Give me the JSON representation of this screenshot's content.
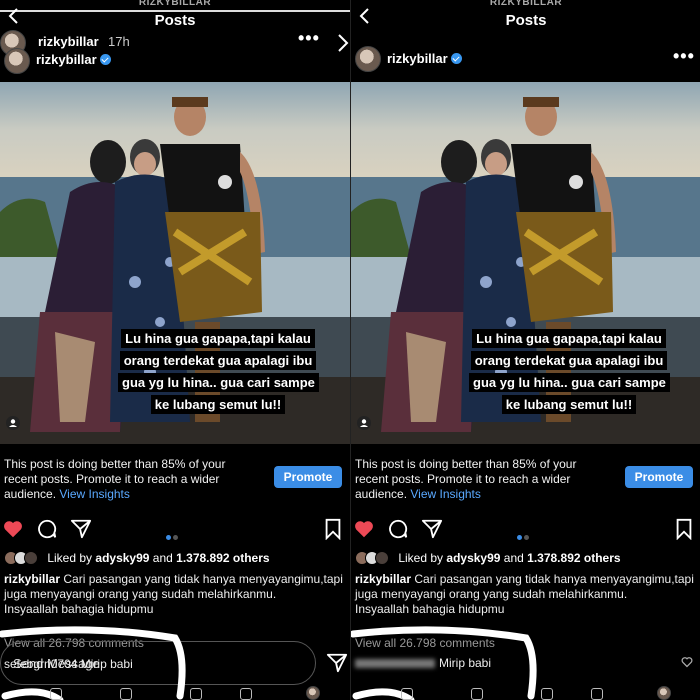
{
  "pretitle": "RIZKYBILLAR",
  "title": "Posts",
  "story": {
    "username": "rizkybillar",
    "time": "17h"
  },
  "post": {
    "username": "rizkybillar",
    "overlay_text": "Lu hina gua gapapa,tapi kalau orang terdekat gua apalagi ibu gua yg lu hina.. gua cari sampe ke lubang semut lu!!"
  },
  "insight": {
    "text": "This post is doing better than 85% of your recent posts. Promote it to reach a wider audience.",
    "link": "View Insights",
    "button": "Promote"
  },
  "likes": {
    "prefix": "Liked by",
    "user": "adysky99",
    "middle": "and",
    "count": "1.378.892 others"
  },
  "caption": {
    "username": "rizkybillar",
    "text": "Cari pasangan yang tidak hanya menyayangimu,tapi juga menyayangi orang yang sudah melahirkanmu.",
    "line2": "Insyaallah bahagia hidupmu"
  },
  "comments": {
    "view_all": "View all 26.798 comments",
    "right_comment": "Mirip babi",
    "left_comment_user": "setebgrn0704",
    "left_comment": "Mirip babi"
  },
  "message": {
    "placeholder": "Send Message"
  },
  "colors": {
    "accent": "#3b8de6",
    "heart": "#ed4956",
    "verified": "#3897f0",
    "background": "#000000"
  },
  "icons": [
    "back-arrow-icon",
    "more-icon",
    "heart-icon",
    "comment-icon",
    "share-icon",
    "bookmark-icon",
    "send-icon",
    "small-heart-icon"
  ]
}
